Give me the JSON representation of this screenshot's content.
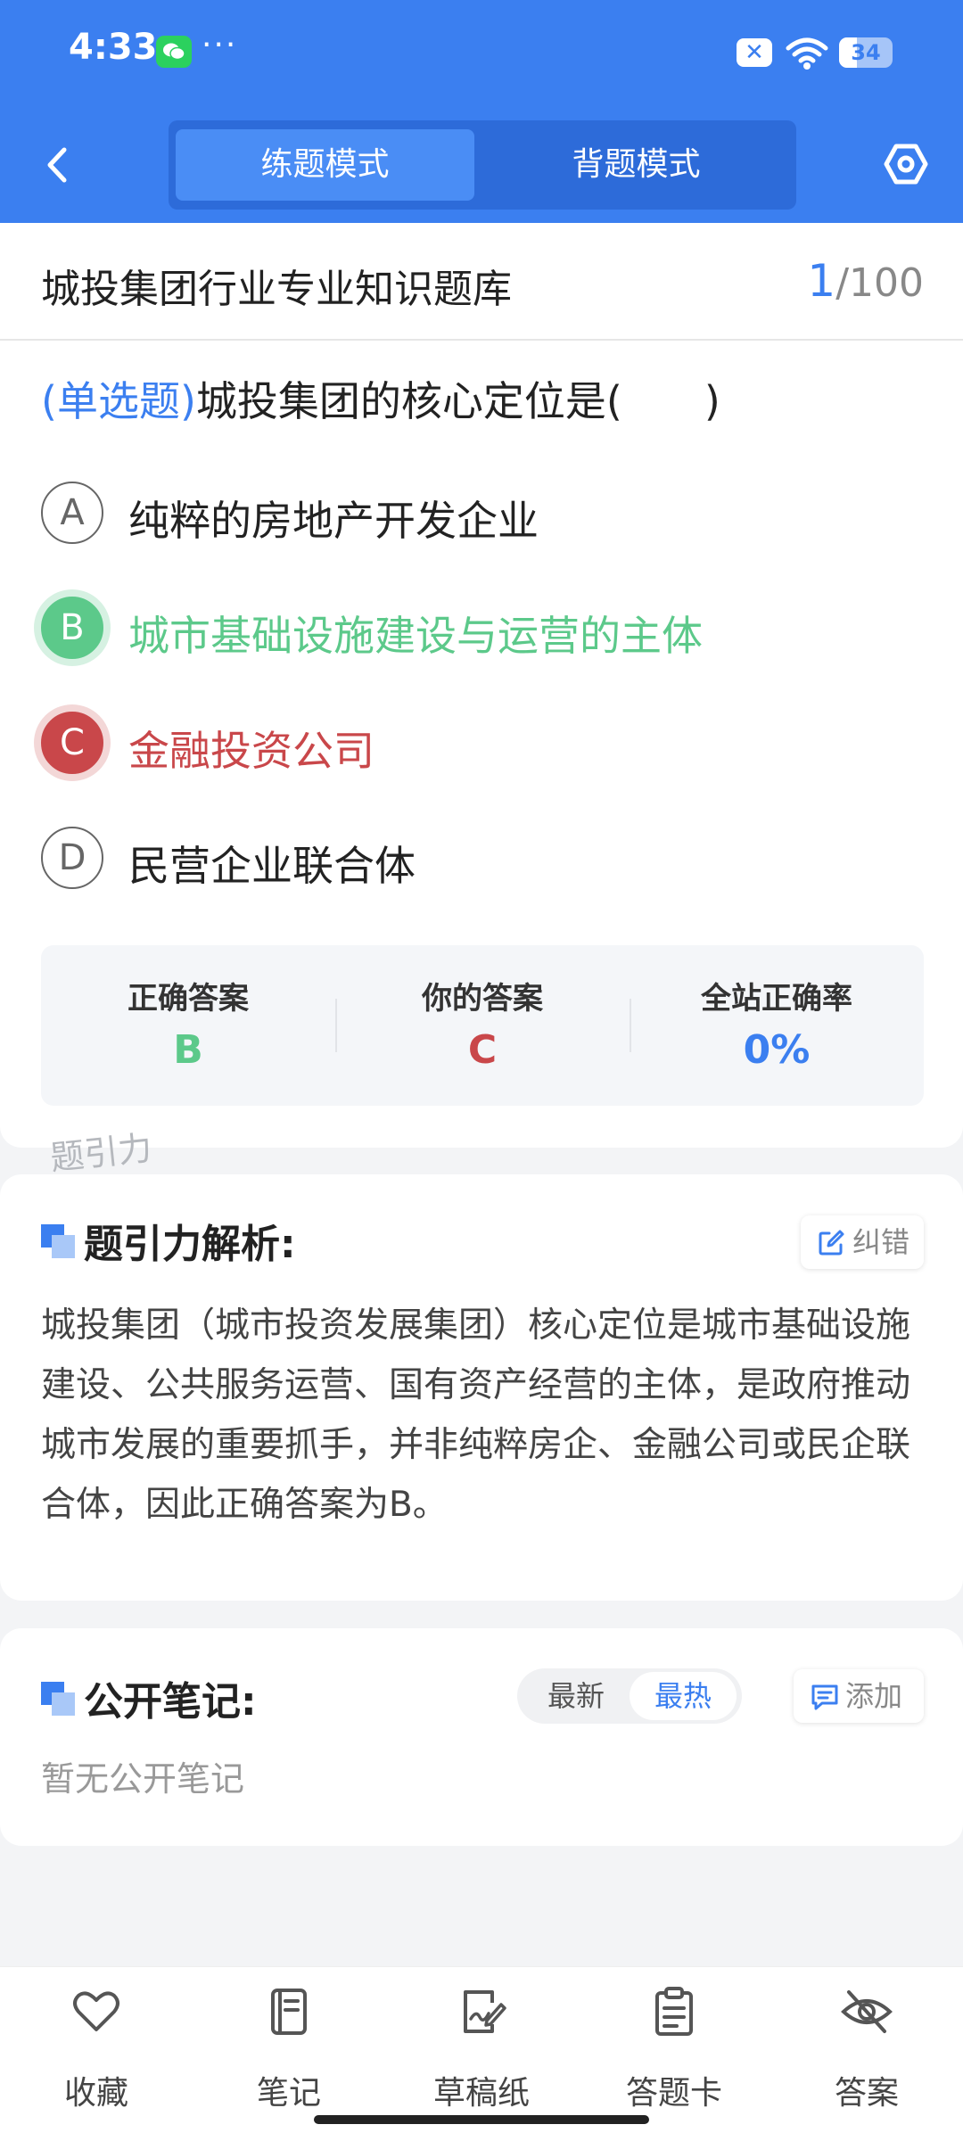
{
  "status_bar": {
    "time": "4:33",
    "dots": "···",
    "battery": "34",
    "battery_level": 0.34
  },
  "header": {
    "modes": [
      "练题模式",
      "背题模式"
    ],
    "active_mode": 0
  },
  "quiz": {
    "bank_title": "城投集团行业专业知识题库",
    "current": "1",
    "total": "/100",
    "question_type": "(单选题)",
    "question": "城投集团的核心定位是(　　)",
    "options": [
      {
        "letter": "A",
        "text": "纯粹的房地产开发企业",
        "state": "normal"
      },
      {
        "letter": "B",
        "text": "城市基础设施建设与运营的主体",
        "state": "correct"
      },
      {
        "letter": "C",
        "text": "金融投资公司",
        "state": "wrong"
      },
      {
        "letter": "D",
        "text": "民营企业联合体",
        "state": "normal"
      }
    ],
    "stats": [
      {
        "label": "正确答案",
        "value": "B",
        "color": "#5cc98a"
      },
      {
        "label": "你的答案",
        "value": "C",
        "color": "#c9474a"
      },
      {
        "label": "全站正确率",
        "value": "0%",
        "color": "#3b7ff0"
      }
    ],
    "watermark": "题引力"
  },
  "analysis": {
    "title": "题引力解析:",
    "correct_btn": "纠错",
    "text": "城投集团（城市投资发展集团）核心定位是城市基础设施建设、公共服务运营、国有资产经营的主体，是政府推动城市发展的重要抓手，并非纯粹房企、金融公司或民企联合体，因此正确答案为B。"
  },
  "notes": {
    "title": "公开笔记:",
    "sort_options": [
      "最新",
      "最热"
    ],
    "active_sort": 1,
    "add_btn": "添加",
    "empty_text": "暂无公开笔记"
  },
  "bottom_nav": [
    {
      "label": "收藏",
      "icon": "heart-icon"
    },
    {
      "label": "笔记",
      "icon": "notebook-icon"
    },
    {
      "label": "草稿纸",
      "icon": "draft-icon"
    },
    {
      "label": "答题卡",
      "icon": "clipboard-icon"
    },
    {
      "label": "答案",
      "icon": "eye-off-icon"
    }
  ],
  "colors": {
    "primary": "#3b7ff0",
    "correct": "#5cc98a",
    "wrong": "#c9474a"
  }
}
